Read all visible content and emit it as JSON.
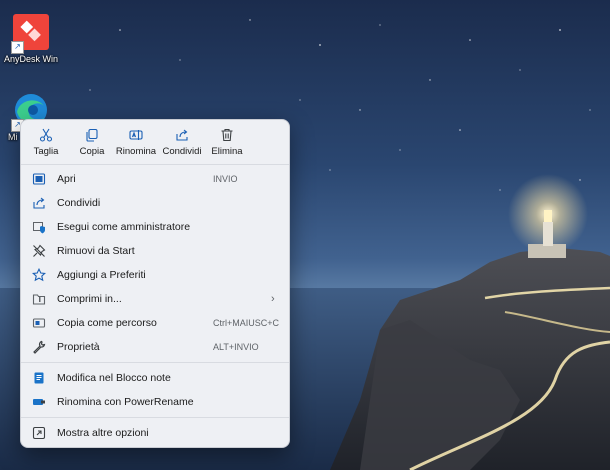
{
  "desktop": {
    "icons": [
      {
        "label": "AnyDesk Win",
        "icon": "anydesk-icon"
      },
      {
        "label": "Mi",
        "icon": "edge-icon"
      }
    ]
  },
  "menu": {
    "toolbar": [
      {
        "label": "Taglia",
        "icon": "scissors-icon"
      },
      {
        "label": "Copia",
        "icon": "copy-icon"
      },
      {
        "label": "Rinomina",
        "icon": "rename-icon"
      },
      {
        "label": "Condividi",
        "icon": "share-icon"
      },
      {
        "label": "Elimina",
        "icon": "trash-icon"
      }
    ],
    "items": [
      {
        "label": "Apri",
        "shortcut": "INVIO",
        "icon": "open-icon"
      },
      {
        "label": "Condividi",
        "shortcut": "",
        "icon": "share-icon"
      },
      {
        "label": "Esegui come amministratore",
        "shortcut": "",
        "icon": "admin-shield-icon"
      },
      {
        "label": "Rimuovi da Start",
        "shortcut": "",
        "icon": "unpin-icon"
      },
      {
        "label": "Aggiungi a Preferiti",
        "shortcut": "",
        "icon": "star-icon"
      },
      {
        "label": "Comprimi in...",
        "shortcut": "",
        "icon": "zip-folder-icon",
        "submenu": "›"
      },
      {
        "label": "Copia come percorso",
        "shortcut": "Ctrl+MAIUSC+C",
        "icon": "path-icon"
      },
      {
        "label": "Proprietà",
        "shortcut": "ALT+INVIO",
        "icon": "wrench-icon"
      },
      {
        "label": "Modifica nel Blocco note",
        "shortcut": "",
        "icon": "notepad-icon"
      },
      {
        "label": "Rinomina con PowerRename",
        "shortcut": "",
        "icon": "powerrename-icon"
      },
      {
        "label": "Mostra altre opzioni",
        "shortcut": "",
        "icon": "more-options-icon"
      }
    ]
  },
  "colors": {
    "accent": "#1a73c8",
    "menu_bg": "#eef0f4",
    "anydesk": "#ef443b"
  }
}
